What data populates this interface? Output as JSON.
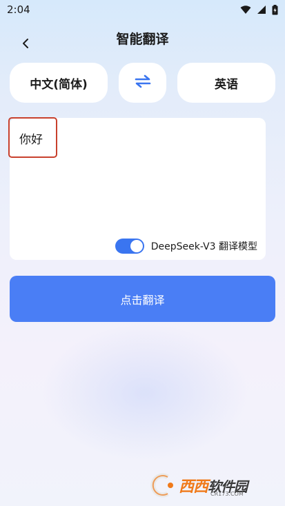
{
  "status_bar": {
    "time": "2:04"
  },
  "header": {
    "title": "智能翻译"
  },
  "languages": {
    "source": "中文(简体)",
    "target": "英语"
  },
  "input": {
    "text": "你好"
  },
  "model": {
    "label": "DeepSeek-V3 翻译模型",
    "enabled": true
  },
  "actions": {
    "translate_label": "点击翻译"
  },
  "watermark": {
    "brand_primary": "西西",
    "brand_secondary": "软件园",
    "sub": "CR173.COM"
  },
  "colors": {
    "accent": "#4a7ef5",
    "highlight": "#c8402c",
    "watermark": "#f07a1a"
  }
}
